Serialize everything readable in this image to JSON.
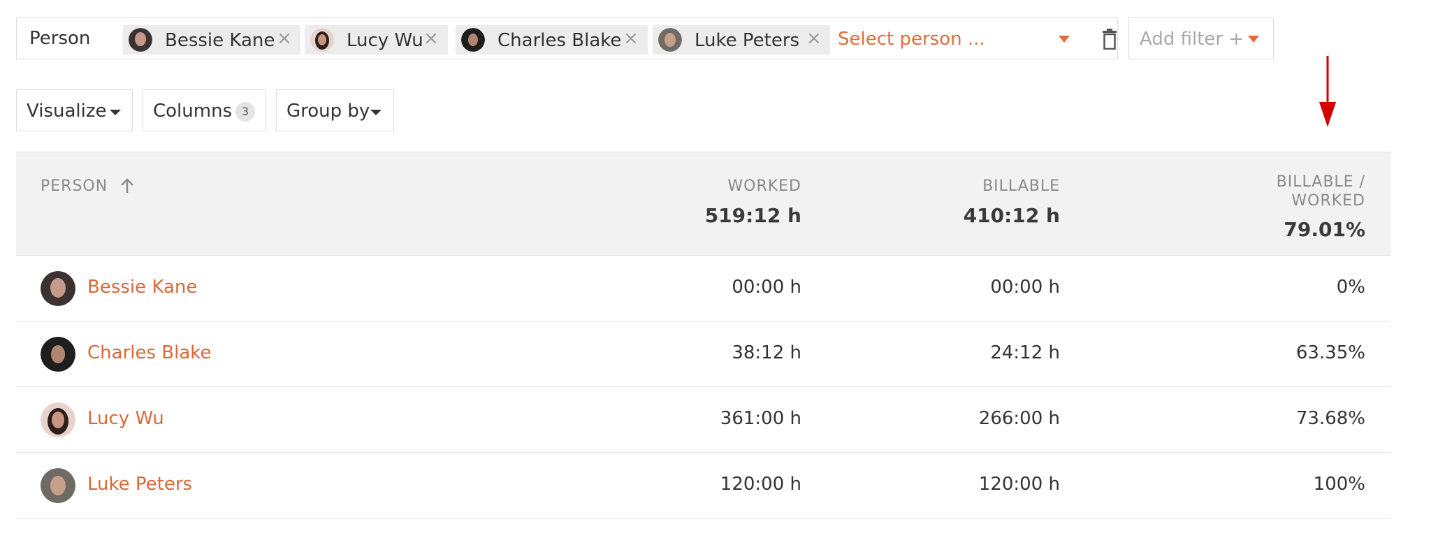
{
  "filter": {
    "label": "Person",
    "chips": [
      {
        "name": "Bessie Kane",
        "remove": "×"
      },
      {
        "name": "Lucy Wu",
        "remove": "×"
      },
      {
        "name": "Charles Blake",
        "remove": "×"
      },
      {
        "name": "Luke Peters",
        "remove": "×"
      }
    ],
    "select_placeholder": "Select person ...",
    "add_filter_label": "Add filter +"
  },
  "toolbar": {
    "visualize_label": "Visualize",
    "columns_label": "Columns",
    "columns_count": "3",
    "groupby_label": "Group by"
  },
  "table": {
    "headers": {
      "person": "PERSON",
      "worked": "WORKED",
      "billable": "BILLABLE",
      "ratio_line1": "BILLABLE /",
      "ratio_line2": "WORKED"
    },
    "totals": {
      "worked": "519:12 h",
      "billable": "410:12 h",
      "ratio": "79.01%"
    },
    "rows": [
      {
        "name": "Bessie Kane",
        "worked": "00:00 h",
        "billable": "00:00 h",
        "ratio": "0%"
      },
      {
        "name": "Charles Blake",
        "worked": "38:12 h",
        "billable": "24:12 h",
        "ratio": "63.35%"
      },
      {
        "name": "Lucy Wu",
        "worked": "361:00 h",
        "billable": "266:00 h",
        "ratio": "73.68%"
      },
      {
        "name": "Luke Peters",
        "worked": "120:00 h",
        "billable": "120:00 h",
        "ratio": "100%"
      }
    ]
  },
  "colors": {
    "accent": "#d9683a",
    "annotation": "#d40000",
    "header_bg": "#f2f2f2",
    "chip_bg": "#ececec"
  },
  "icons": {
    "remove": "close-icon",
    "dropdown": "chevron-down-icon",
    "delete": "trash-icon",
    "sort": "arrow-up-icon",
    "annotation": "red-arrow-down-icon"
  }
}
